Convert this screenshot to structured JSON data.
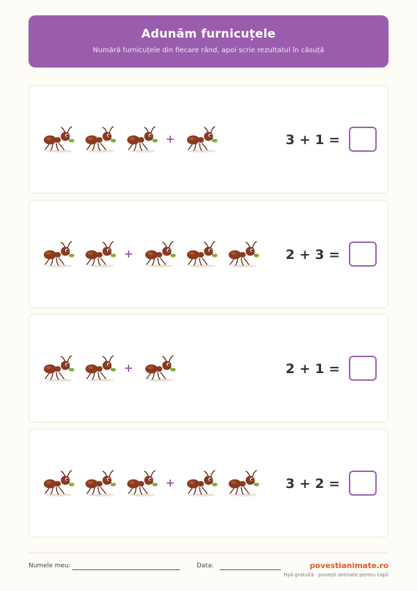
{
  "header": {
    "title": "Adunăm furnicuțele",
    "subtitle": "Numără furnicuțele din fiecare rând, apoi scrie rezultatul în căsuță"
  },
  "exercises": [
    {
      "left_count": 3,
      "right_count": 1,
      "equation": "3 + 1 =",
      "answer": ""
    },
    {
      "left_count": 2,
      "right_count": 3,
      "equation": "2 + 3 =",
      "answer": ""
    },
    {
      "left_count": 2,
      "right_count": 1,
      "equation": "2 + 1 =",
      "answer": ""
    },
    {
      "left_count": 3,
      "right_count": 2,
      "equation": "3 + 2 =",
      "answer": ""
    }
  ],
  "plus_sign": "+",
  "footer": {
    "name_label": "Numele meu:",
    "date_label": "Data:",
    "brand": "povestianimate.ro",
    "tagline": "Fișă gratuită · povești animate pentru copii"
  },
  "colors": {
    "accent": "#9a5cad",
    "brand": "#e05a2a",
    "ant": "#8a3a1f"
  },
  "icons": {
    "ant": "ant-icon"
  }
}
